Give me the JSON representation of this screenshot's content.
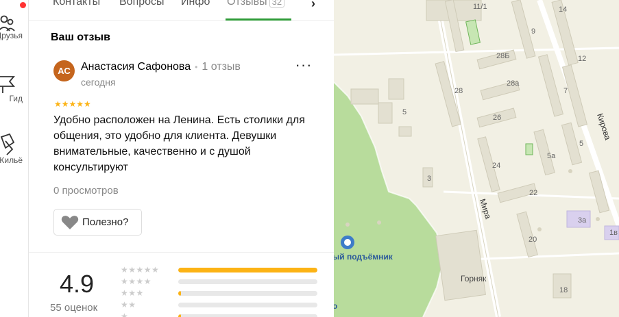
{
  "rail": {
    "items": [
      {
        "label": "Друзья",
        "icon": "friends-icon"
      },
      {
        "label": "Гид",
        "icon": "flag-icon"
      },
      {
        "label": "Жильё",
        "icon": "luggage-icon"
      }
    ]
  },
  "tabs": {
    "items": [
      "Контакты",
      "Вопросы",
      "Инфо",
      "Отзывы"
    ],
    "reviews_count": "32",
    "active": "Отзывы"
  },
  "review_section": {
    "title": "Ваш отзыв",
    "avatar_initials": "АС",
    "author": "Анастасия Сафонова",
    "author_reviews": "1 отзыв",
    "date": "сегодня",
    "rating": 5,
    "stars": "★★★★★",
    "text": "Удобно расположен на Ленина. Есть столики для общения, это удобно для клиента. Девушки внимательные, качественно и с душой консультируют",
    "views": "0 просмотров",
    "helpful_label": "Полезно?"
  },
  "rating_summary": {
    "score": "4.9",
    "count_label": "55 оценок",
    "distribution": [
      {
        "stars": "★★★★★",
        "fraction": 1.0
      },
      {
        "stars": "★★★★",
        "fraction": 0.0
      },
      {
        "stars": "★★★",
        "fraction": 0.02
      },
      {
        "stars": "★★",
        "fraction": 0.0
      },
      {
        "stars": "★",
        "fraction": 0.02
      }
    ]
  },
  "map": {
    "streets": [
      "Мира",
      "Кирова"
    ],
    "poi": "ый подъёмник",
    "poi_tail": "о",
    "building_name": "Горняк",
    "house_numbers": [
      "11/1",
      "14",
      "9",
      "28Б",
      "12",
      "28",
      "28а",
      "7",
      "5",
      "26",
      "3",
      "24",
      "5а",
      "5",
      "22",
      "3а",
      "1в",
      "20",
      "18"
    ]
  },
  "colors": {
    "accent_green": "#2e9b37",
    "star_yellow": "#fcb315",
    "avatar": "#c5651d",
    "notification": "#ff3333",
    "forest": "#b8dc9c"
  }
}
